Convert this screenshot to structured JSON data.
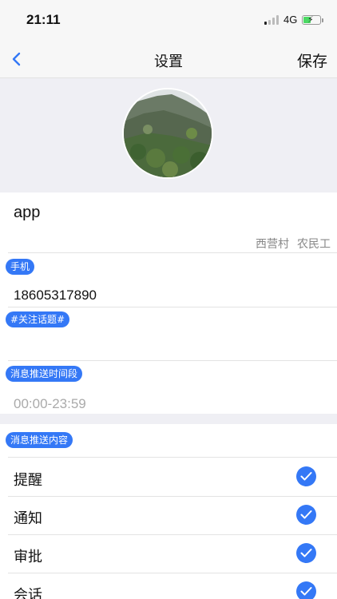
{
  "status_bar": {
    "time": "21:11",
    "network": "4G"
  },
  "nav": {
    "title": "设置",
    "save_label": "保存"
  },
  "profile": {
    "name_value": "app",
    "location": [
      "西营村",
      "农民工"
    ]
  },
  "fields": {
    "phone_label": "手机",
    "phone_value": "18605317890",
    "topic_label": "#关注话题#",
    "topic_value": "",
    "push_time_label": "消息推送时间段",
    "push_time_placeholder": "00:00-23:59"
  },
  "push_content": {
    "label": "消息推送内容",
    "items": [
      {
        "label": "提醒",
        "checked": true
      },
      {
        "label": "通知",
        "checked": true
      },
      {
        "label": "审批",
        "checked": true
      },
      {
        "label": "会话",
        "checked": true
      }
    ]
  },
  "colors": {
    "accent": "#3478f6",
    "battery": "#4cd964"
  }
}
